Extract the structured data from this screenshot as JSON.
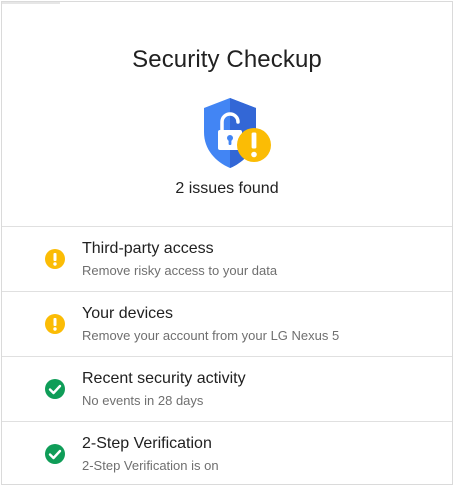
{
  "page": {
    "title": "Security Checkup",
    "summary": "2 issues found",
    "hero_icon": "shield-unlocked-warning-icon"
  },
  "colors": {
    "warning": "#fbbc05",
    "ok": "#0f9d58",
    "shield": "#4285f4"
  },
  "items": [
    {
      "title": "Third-party access",
      "subtitle": "Remove risky access to your data",
      "status": "warning",
      "icon": "warning-icon"
    },
    {
      "title": "Your devices",
      "subtitle": "Remove your account from your LG Nexus 5",
      "status": "warning",
      "icon": "warning-icon"
    },
    {
      "title": "Recent security activity",
      "subtitle": "No events in 28 days",
      "status": "ok",
      "icon": "check-icon"
    },
    {
      "title": "2-Step Verification",
      "subtitle": "2-Step Verification is on",
      "status": "ok",
      "icon": "check-icon"
    }
  ]
}
